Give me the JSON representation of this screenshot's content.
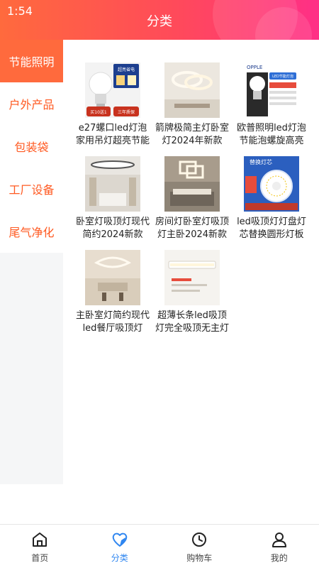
{
  "status_bar": {
    "time": "1:54"
  },
  "header": {
    "title": "分类"
  },
  "colors": {
    "accent": "#ff6a3d",
    "accent_text": "#ff5a22",
    "active_tab": "#2f86f0"
  },
  "sidebar": {
    "items": [
      {
        "label": "节能照明",
        "active": true
      },
      {
        "label": "户外产品",
        "active": false
      },
      {
        "label": "包装袋",
        "active": false
      },
      {
        "label": "工厂设备",
        "active": false
      },
      {
        "label": "尾气净化",
        "active": false
      }
    ]
  },
  "products": [
    {
      "name": "e27螺口led灯泡家用吊灯超亮节能",
      "image": "led-bulb-boxed-image",
      "thumb_texts": [
        "超亮省电",
        "买10送1",
        "三年质保"
      ]
    },
    {
      "name": "箭牌极简主灯卧室灯2024年新款",
      "image": "ceiling-ring-lamp-image",
      "thumb_texts": []
    },
    {
      "name": "欧普照明led灯泡节能泡螺旋高亮",
      "image": "opple-led-bulb-image",
      "thumb_texts": [
        "OPPLE",
        "LED节能灯泡"
      ]
    },
    {
      "name": "卧室灯吸顶灯现代简约2024新款",
      "image": "bedroom-ceiling-light-image",
      "thumb_texts": []
    },
    {
      "name": "房间灯卧室灯吸顶灯主卧2024新款",
      "image": "square-ceiling-light-image",
      "thumb_texts": []
    },
    {
      "name": "led吸顶灯灯盘灯芯替换圆形灯板",
      "image": "led-panel-module-image",
      "thumb_texts": [
        "替换灯芯"
      ]
    },
    {
      "name": "主卧室灯简约现代led餐厅吸顶灯",
      "image": "dining-ceiling-light-image",
      "thumb_texts": []
    },
    {
      "name": "超薄长条led吸顶灯完全吸顶无主灯",
      "image": "slim-strip-light-image",
      "thumb_texts": []
    }
  ],
  "tabbar": {
    "items": [
      {
        "label": "首页",
        "icon": "home-icon",
        "active": false
      },
      {
        "label": "分类",
        "icon": "heart-icon",
        "active": true
      },
      {
        "label": "购物车",
        "icon": "clock-icon",
        "active": false
      },
      {
        "label": "我的",
        "icon": "person-icon",
        "active": false
      }
    ]
  }
}
